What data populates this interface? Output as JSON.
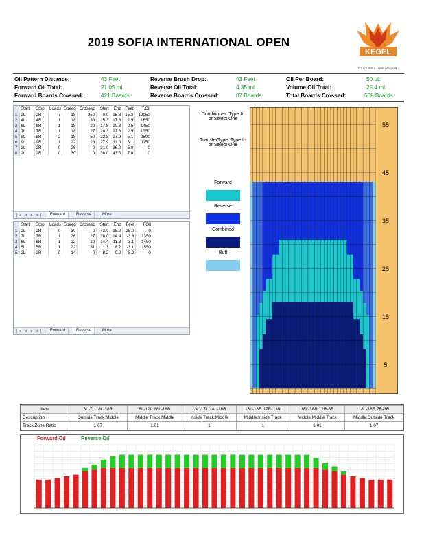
{
  "header": {
    "title": "2019 SOFIA INTERNATIONAL OPEN",
    "logo_text": "KEGEL",
    "logo_tagline": "YOUR LANES · OUR PASSION"
  },
  "stats": {
    "oil_pattern_distance": {
      "label": "Oil Pattern Distance:",
      "value": "43 Feet"
    },
    "forward_oil_total": {
      "label": "Forward Oil Total:",
      "value": "21.05 mL"
    },
    "forward_boards_crossed": {
      "label": "Forward Boards Crossed:",
      "value": "421 Boards"
    },
    "reverse_brush_drop": {
      "label": "Reverse Brush Drop:",
      "value": "43 Feet"
    },
    "reverse_oil_total": {
      "label": "Reverse Oil Total:",
      "value": "4.35 mL"
    },
    "reverse_boards_crossed": {
      "label": "Reverse Boards Crossed:",
      "value": "87 Boards"
    },
    "oil_per_board": {
      "label": "Oil Per Board:",
      "value": "50 uL"
    },
    "volume_oil_total": {
      "label": "Volume Oil Total:",
      "value": "25.4 mL"
    },
    "total_boards_crossed": {
      "label": "Total Boards Crossed:",
      "value": "508 Boards"
    }
  },
  "columns": [
    "Start",
    "Stop",
    "Loads",
    "Speed",
    "Crossed",
    "Start",
    "End",
    "Feet",
    "T.Oil"
  ],
  "forward_table": {
    "rows": [
      [
        "1",
        "2L",
        "2R",
        "7",
        "18",
        "259",
        "0.0",
        "15.3",
        "15.3",
        "12950"
      ],
      [
        "2",
        "4L",
        "4R",
        "1",
        "18",
        "33",
        "15.3",
        "17.8",
        "2.5",
        "1650"
      ],
      [
        "3",
        "6L",
        "6R",
        "1",
        "18",
        "29",
        "17.8",
        "20.3",
        "2.5",
        "1450"
      ],
      [
        "4",
        "7L",
        "7R",
        "1",
        "18",
        "27",
        "20.3",
        "22.8",
        "2.5",
        "1350"
      ],
      [
        "5",
        "8L",
        "8R",
        "2",
        "18",
        "50",
        "22.8",
        "27.9",
        "5.1",
        "2500"
      ],
      [
        "6",
        "9L",
        "9R",
        "1",
        "22",
        "23",
        "27.9",
        "31.0",
        "3.1",
        "1150"
      ],
      [
        "7",
        "2L",
        "2R",
        "0",
        "26",
        "0",
        "31.0",
        "36.0",
        "5.0",
        "0"
      ],
      [
        "8",
        "2L",
        "2R",
        "0",
        "30",
        "0",
        "36.0",
        "43.0",
        "7.0",
        "0"
      ]
    ],
    "tabs": [
      "Forward",
      "Reverse",
      "More"
    ],
    "active_tab": "Forward"
  },
  "reverse_table": {
    "rows": [
      [
        "1",
        "2L",
        "2R",
        "0",
        "30",
        "0",
        "43.0",
        "18.0",
        "-25.0",
        "0"
      ],
      [
        "2",
        "7L",
        "7R",
        "1",
        "26",
        "27",
        "18.0",
        "14.4",
        "-3.6",
        "1350"
      ],
      [
        "3",
        "6L",
        "6R",
        "1",
        "22",
        "29",
        "14.4",
        "11.3",
        "-3.1",
        "1450"
      ],
      [
        "4",
        "5L",
        "5R",
        "1",
        "22",
        "31",
        "11.3",
        "8.2",
        "-3.1",
        "1550"
      ],
      [
        "5",
        "2L",
        "2R",
        "0",
        "14",
        "0",
        "8.2",
        "0.0",
        "-8.2",
        "0"
      ]
    ],
    "tabs": [
      "Forward",
      "Reverse",
      "More"
    ],
    "active_tab": "Reverse"
  },
  "legend": {
    "conditioner": "Conditioner: Type In or Select One",
    "transfer_type": "TransferType: Type In or Select One",
    "forward": "Forward",
    "reverse": "Reverse",
    "combined": "Combined",
    "buff": "Buff",
    "colors": {
      "forward": "#19c9cf",
      "reverse": "#1030e6",
      "combined": "#0a1a7d",
      "buff": "#87ceee",
      "dry": "#f5c36b"
    }
  },
  "pattern_ruler": [
    "55",
    "45",
    "35",
    "25",
    "15",
    "5"
  ],
  "oil_info": {
    "header": [
      "Item",
      "3L-7L:18L-18R",
      "8L-12L:18L-18R",
      "13L-17L:18L-18R",
      "18L-18R:17R-13R",
      "18L-18R:12R-8R",
      "18L-18R:7R-3R"
    ],
    "description": [
      "Description",
      "Outside Track:Middle",
      "Middle Track:Middle",
      "Inside Track:Middle",
      "Middle:Inside Track",
      "Middle:Middle Track",
      "Middle:Outside Track"
    ],
    "ratio": [
      "Track Zone Ratio",
      "1.67",
      "1.01",
      "1",
      "1",
      "1.01",
      "1.67"
    ]
  },
  "chart_data": {
    "type": "bar",
    "title": "",
    "series": [
      {
        "name": "Forward Oil",
        "color": "#e02020",
        "values": [
          850,
          850,
          900,
          950,
          1000,
          1100,
          1150,
          1200,
          1200,
          1200,
          1200,
          1200,
          1200,
          1200,
          1200,
          1200,
          1200,
          1200,
          1200,
          1200,
          1200,
          1200,
          1200,
          1200,
          1200,
          1200,
          1200,
          1200,
          1200,
          1200,
          1200,
          1150,
          1100,
          1000,
          950,
          900,
          850,
          850,
          850
        ]
      },
      {
        "name": "Reverse Oil",
        "color": "#22cc22",
        "values": [
          0,
          0,
          0,
          0,
          0,
          100,
          150,
          250,
          350,
          400,
          400,
          400,
          400,
          400,
          400,
          400,
          400,
          400,
          400,
          400,
          400,
          400,
          400,
          400,
          400,
          400,
          400,
          400,
          400,
          400,
          300,
          200,
          150,
          100,
          0,
          0,
          0,
          0,
          0
        ]
      }
    ],
    "stacked": true,
    "ylim": [
      0,
      1900
    ],
    "legend": "top-left"
  }
}
